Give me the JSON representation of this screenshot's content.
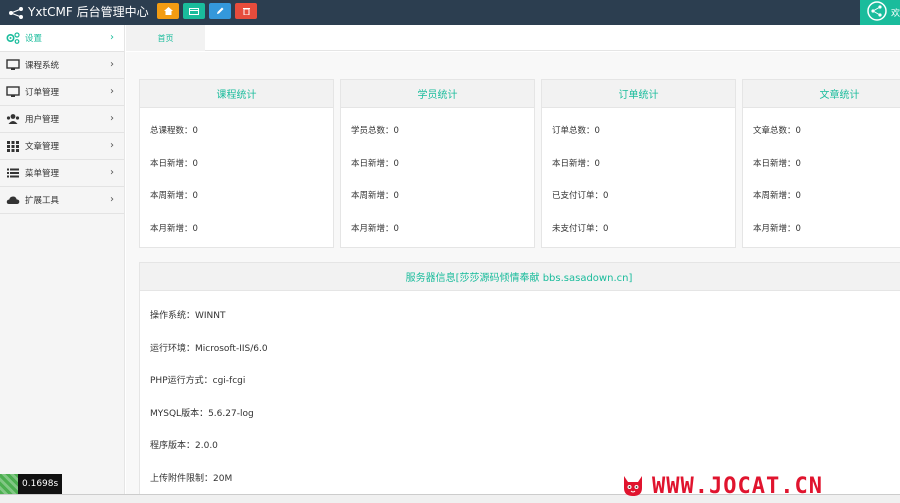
{
  "app": {
    "title": "YxtCMF 后台管理中心"
  },
  "topbar": {
    "user_text": "欢"
  },
  "sidebar": {
    "items": [
      {
        "label": "设置",
        "icon": "gears-icon",
        "active": true
      },
      {
        "label": "课程系统",
        "icon": "monitor-icon"
      },
      {
        "label": "订单管理",
        "icon": "monitor-icon"
      },
      {
        "label": "用户管理",
        "icon": "users-icon"
      },
      {
        "label": "文章管理",
        "icon": "grid-icon"
      },
      {
        "label": "菜单管理",
        "icon": "list-icon"
      },
      {
        "label": "扩展工具",
        "icon": "cloud-icon"
      }
    ],
    "chevron": "›"
  },
  "tabs": [
    {
      "label": "首页"
    }
  ],
  "cards": [
    {
      "title": "课程统计",
      "rows": [
        "总课程数：0",
        "本日新增：0",
        "本周新增：0",
        "本月新增：0"
      ]
    },
    {
      "title": "学员统计",
      "rows": [
        "学员总数：0",
        "本日新增：0",
        "本周新增：0",
        "本月新增：0"
      ]
    },
    {
      "title": "订单统计",
      "rows": [
        "订单总数：0",
        "本日新增：0",
        "已支付订单：0",
        "未支付订单：0"
      ]
    },
    {
      "title": "文章统计",
      "rows": [
        "文章总数：0",
        "本日新增：0",
        "本周新增：0",
        "本月新增：0"
      ]
    }
  ],
  "server": {
    "title": "服务器信息[莎莎源码倾情奉献 bbs.sasadown.cn]",
    "rows": [
      "操作系统：WINNT",
      "运行环境：Microsoft-IIS/6.0",
      "PHP运行方式：cgi-fcgi",
      "MYSQL版本：5.6.27-log",
      "程序版本：2.0.0",
      "上传附件限制：20M"
    ]
  },
  "timer": {
    "value": "0.1698s"
  },
  "watermark": {
    "text": "WWW.JOCAT.CN"
  },
  "colors": {
    "accent": "#1abc9c",
    "topbar": "#2c3e50",
    "watermark": "#e0142e"
  }
}
